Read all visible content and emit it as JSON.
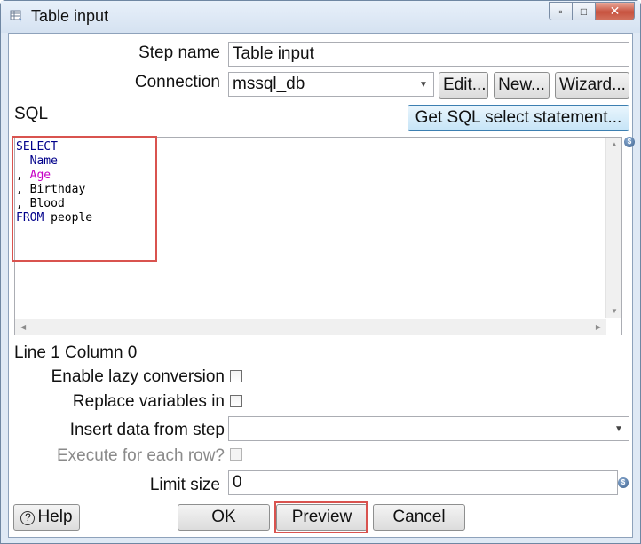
{
  "window": {
    "title": "Table input",
    "title_icon": "table-input-icon",
    "controls": {
      "minimize": "minimize-icon",
      "maximize": "maximize-icon",
      "close": "close-icon"
    }
  },
  "form": {
    "step_name_label": "Step name",
    "step_name_value": "Table input",
    "connection_label": "Connection",
    "connection_value": "mssql_db",
    "edit_button": "Edit...",
    "new_button": "New...",
    "wizard_button": "Wizard...",
    "sql_label": "SQL",
    "get_sql_button": "Get SQL select statement...",
    "sql_lines": {
      "l1": "SELECT",
      "l2": "  Name",
      "l3_prefix": ", ",
      "l3_word": "Age",
      "l4": ", Birthday",
      "l5": ", Blood",
      "l6_kw": "FROM",
      "l6_rest": " people"
    },
    "cursor_position": "Line 1 Column 0",
    "lazy_conversion_label": "Enable lazy conversion",
    "lazy_conversion_checked": false,
    "replace_variables_label": "Replace variables in",
    "replace_variables_checked": false,
    "insert_data_label": "Insert data from step",
    "insert_data_value": "",
    "execute_each_row_label": "Execute for each row?",
    "execute_each_row_checked": false,
    "limit_size_label": "Limit size",
    "limit_size_value": "0"
  },
  "footer": {
    "help_button": "Help",
    "ok_button": "OK",
    "preview_button": "Preview",
    "cancel_button": "Cancel"
  },
  "colors": {
    "sql_keyword": "#00008b",
    "sql_highlight_word": "#c600c6",
    "annotation_box": "#d9534f"
  }
}
